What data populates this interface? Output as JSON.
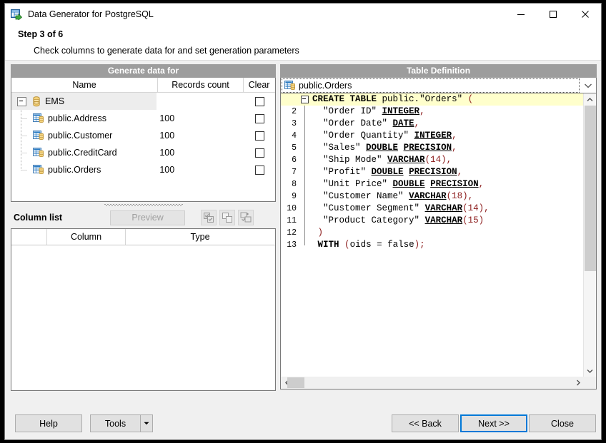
{
  "window": {
    "title": "Data Generator for PostgreSQL",
    "app_icon": "data-generator-icon",
    "minimize_label": "─",
    "maximize_label": "□",
    "close_label": "✕"
  },
  "header": {
    "step": "Step 3 of 6",
    "description": "Check columns to generate data for and set generation parameters"
  },
  "left": {
    "panel_title": "Generate data for",
    "columns": [
      "Name",
      "Records count",
      "Clear"
    ],
    "tree": [
      {
        "label": "EMS",
        "records": "",
        "icon": "database-icon",
        "level": 0,
        "selected": true,
        "expanded": true
      },
      {
        "label": "public.Address",
        "records": "100",
        "icon": "table-icon",
        "level": 1,
        "selected": false
      },
      {
        "label": "public.Customer",
        "records": "100",
        "icon": "table-icon",
        "level": 1,
        "selected": false
      },
      {
        "label": "public.CreditCard",
        "records": "100",
        "icon": "table-icon",
        "level": 1,
        "selected": false
      },
      {
        "label": "public.Orders",
        "records": "100",
        "icon": "table-icon",
        "level": 1,
        "selected": false
      }
    ],
    "column_list": {
      "title": "Column list",
      "preview_label": "Preview",
      "preview_disabled": true,
      "tool_buttons": [
        "check-all-icon",
        "uncheck-all-icon",
        "invert-check-icon"
      ],
      "columns": [
        "",
        "Column",
        "Type"
      ],
      "rows": []
    }
  },
  "right": {
    "panel_title": "Table Definition",
    "selected_table": "public.Orders",
    "selected_table_icon": "table-icon",
    "dropdown_icon": "chevron-down-icon",
    "sql_lines": [
      {
        "n": "",
        "active": true,
        "fold": "start",
        "tokens": [
          {
            "t": "CREATE",
            "c": "kw"
          },
          {
            "t": " ",
            "c": ""
          },
          {
            "t": "TABLE",
            "c": "kw"
          },
          {
            "t": " public.",
            "c": ""
          },
          {
            "t": "\"Orders\"",
            "c": "str"
          },
          {
            "t": " ",
            "c": ""
          },
          {
            "t": "(",
            "c": "pun"
          }
        ]
      },
      {
        "n": "2",
        "active": false,
        "fold": "line",
        "tokens": [
          {
            "t": "   ",
            "c": ""
          },
          {
            "t": "\"Order ID\"",
            "c": "str"
          },
          {
            "t": " ",
            "c": ""
          },
          {
            "t": "INTEGER",
            "c": "typ"
          },
          {
            "t": ",",
            "c": "pun"
          }
        ]
      },
      {
        "n": "3",
        "active": false,
        "fold": "line",
        "tokens": [
          {
            "t": "   ",
            "c": ""
          },
          {
            "t": "\"Order Date\"",
            "c": "str"
          },
          {
            "t": " ",
            "c": ""
          },
          {
            "t": "DATE",
            "c": "typ"
          },
          {
            "t": ",",
            "c": "pun"
          }
        ]
      },
      {
        "n": "4",
        "active": false,
        "fold": "line",
        "tokens": [
          {
            "t": "   ",
            "c": ""
          },
          {
            "t": "\"Order Quantity\"",
            "c": "str"
          },
          {
            "t": " ",
            "c": ""
          },
          {
            "t": "INTEGER",
            "c": "typ"
          },
          {
            "t": ",",
            "c": "pun"
          }
        ]
      },
      {
        "n": "5",
        "active": false,
        "fold": "line",
        "tokens": [
          {
            "t": "   ",
            "c": ""
          },
          {
            "t": "\"Sales\"",
            "c": "str"
          },
          {
            "t": " ",
            "c": ""
          },
          {
            "t": "DOUBLE",
            "c": "typ"
          },
          {
            "t": " ",
            "c": ""
          },
          {
            "t": "PRECISION",
            "c": "typ"
          },
          {
            "t": ",",
            "c": "pun"
          }
        ]
      },
      {
        "n": "6",
        "active": false,
        "fold": "line",
        "tokens": [
          {
            "t": "   ",
            "c": ""
          },
          {
            "t": "\"Ship Mode\"",
            "c": "str"
          },
          {
            "t": " ",
            "c": ""
          },
          {
            "t": "VARCHAR",
            "c": "typ"
          },
          {
            "t": "(",
            "c": "pun"
          },
          {
            "t": "14",
            "c": "num"
          },
          {
            "t": "),",
            "c": "pun"
          }
        ]
      },
      {
        "n": "7",
        "active": false,
        "fold": "line",
        "tokens": [
          {
            "t": "   ",
            "c": ""
          },
          {
            "t": "\"Profit\"",
            "c": "str"
          },
          {
            "t": " ",
            "c": ""
          },
          {
            "t": "DOUBLE",
            "c": "typ"
          },
          {
            "t": " ",
            "c": ""
          },
          {
            "t": "PRECISION",
            "c": "typ"
          },
          {
            "t": ",",
            "c": "pun"
          }
        ]
      },
      {
        "n": "8",
        "active": false,
        "fold": "line",
        "tokens": [
          {
            "t": "   ",
            "c": ""
          },
          {
            "t": "\"Unit Price\"",
            "c": "str"
          },
          {
            "t": " ",
            "c": ""
          },
          {
            "t": "DOUBLE",
            "c": "typ"
          },
          {
            "t": " ",
            "c": ""
          },
          {
            "t": "PRECISION",
            "c": "typ"
          },
          {
            "t": ",",
            "c": "pun"
          }
        ]
      },
      {
        "n": "9",
        "active": false,
        "fold": "line",
        "tokens": [
          {
            "t": "   ",
            "c": ""
          },
          {
            "t": "\"Customer Name\"",
            "c": "str"
          },
          {
            "t": " ",
            "c": ""
          },
          {
            "t": "VARCHAR",
            "c": "typ"
          },
          {
            "t": "(",
            "c": "pun"
          },
          {
            "t": "18",
            "c": "num"
          },
          {
            "t": "),",
            "c": "pun"
          }
        ]
      },
      {
        "n": "10",
        "active": false,
        "fold": "line",
        "tokens": [
          {
            "t": "   ",
            "c": ""
          },
          {
            "t": "\"Customer Segment\"",
            "c": "str"
          },
          {
            "t": " ",
            "c": ""
          },
          {
            "t": "VARCHAR",
            "c": "typ"
          },
          {
            "t": "(",
            "c": "pun"
          },
          {
            "t": "14",
            "c": "num"
          },
          {
            "t": "),",
            "c": "pun"
          }
        ]
      },
      {
        "n": "11",
        "active": false,
        "fold": "line",
        "tokens": [
          {
            "t": "   ",
            "c": ""
          },
          {
            "t": "\"Product Category\"",
            "c": "str"
          },
          {
            "t": " ",
            "c": ""
          },
          {
            "t": "VARCHAR",
            "c": "typ"
          },
          {
            "t": "(",
            "c": "pun"
          },
          {
            "t": "15",
            "c": "num"
          },
          {
            "t": ")",
            "c": "pun"
          }
        ]
      },
      {
        "n": "12",
        "active": false,
        "fold": "line",
        "tokens": [
          {
            "t": " ",
            "c": ""
          },
          {
            "t": ")",
            "c": "pun"
          }
        ]
      },
      {
        "n": "13",
        "active": false,
        "fold": "end",
        "tokens": [
          {
            "t": " ",
            "c": ""
          },
          {
            "t": "WITH",
            "c": "kw"
          },
          {
            "t": " ",
            "c": ""
          },
          {
            "t": "(",
            "c": "pun"
          },
          {
            "t": "oids = false",
            "c": ""
          },
          {
            "t": ");",
            "c": "pun"
          }
        ]
      }
    ]
  },
  "footer": {
    "help_label": "Help",
    "tools_label": "Tools",
    "tools_arrow_icon": "caret-down-icon",
    "back_label": "<< Back",
    "next_label": "Next >>",
    "close_label": "Close"
  }
}
